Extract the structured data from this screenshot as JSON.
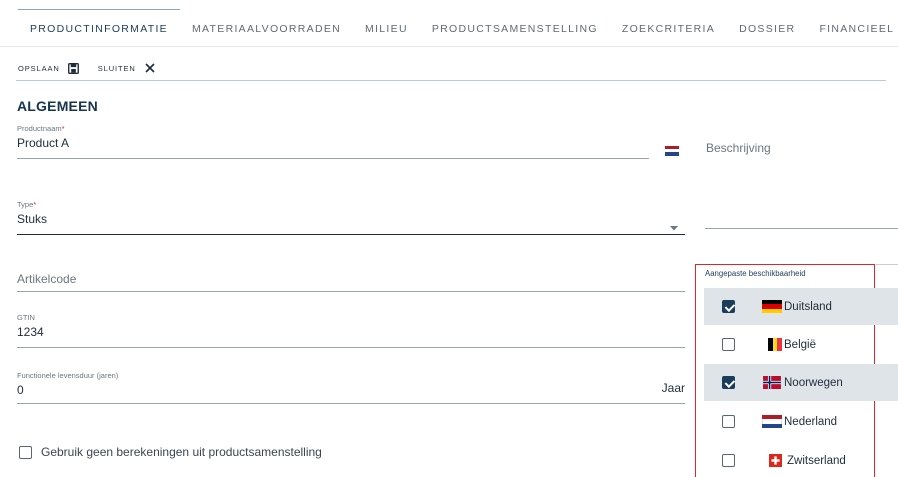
{
  "tabs": [
    {
      "label": "PRODUCTINFORMATIE",
      "active": true
    },
    {
      "label": "MATERIAALVOORRADEN",
      "active": false
    },
    {
      "label": "MILIEU",
      "active": false
    },
    {
      "label": "PRODUCTSAMENSTELLING",
      "active": false
    },
    {
      "label": "ZOEKCRITERIA",
      "active": false
    },
    {
      "label": "DOSSIER",
      "active": false
    },
    {
      "label": "FINANCIEEL",
      "active": false
    }
  ],
  "toolbar": {
    "save_label": "OPSLAAN",
    "save_icon": "floppy-disk-icon",
    "close_label": "SLUITEN",
    "close_icon": "close-icon"
  },
  "section": {
    "title": "ALGEMEEN"
  },
  "fields": {
    "productnaam": {
      "label": "Productnaam",
      "required": "*",
      "value": "Product A",
      "lang_icon": "flag-nl-icon"
    },
    "beschrijving": {
      "placeholder": "Beschrijving"
    },
    "type": {
      "label": "Type",
      "required": "*",
      "value": "Stuks",
      "dropdown_icon": "caret-down-icon"
    },
    "artikelcode": {
      "placeholder": "Artikelcode"
    },
    "gtin": {
      "label": "GTIN",
      "value": "1234"
    },
    "levensduur": {
      "label": "Functionele levensduur (jaren)",
      "value": "0",
      "suffix": "Jaar"
    },
    "geen_berekeningen": {
      "label": "Gebruik geen berekeningen uit productsamenstelling",
      "checked": false
    }
  },
  "availability": {
    "title": "Aangepaste beschikbaarheid",
    "countries": [
      {
        "name": "Duitsland",
        "checked": true,
        "flag": "flag-de-icon"
      },
      {
        "name": "België",
        "checked": false,
        "flag": "flag-be-icon"
      },
      {
        "name": "Noorwegen",
        "checked": true,
        "flag": "flag-no-icon"
      },
      {
        "name": "Nederland",
        "checked": false,
        "flag": "flag-nl-icon"
      },
      {
        "name": "Zwitserland",
        "checked": false,
        "flag": "flag-ch-icon"
      }
    ]
  },
  "colors": {
    "accent": "#1b3d5c",
    "required": "#d12b2b",
    "highlight_border": "#e0252a",
    "selected_row": "#dfe4e9"
  }
}
